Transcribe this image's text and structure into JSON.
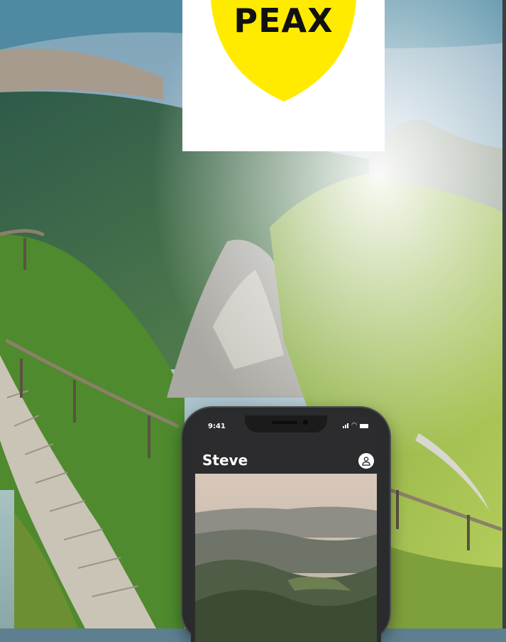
{
  "logo": {
    "text": "PEAX",
    "shield_color": "#ffeb00"
  },
  "phone": {
    "status_time": "9:41",
    "app_title": "Steve",
    "profile_icon": "person-icon"
  },
  "colors": {
    "logo_background": "#ffffff",
    "phone_body": "#2a2b2d"
  }
}
